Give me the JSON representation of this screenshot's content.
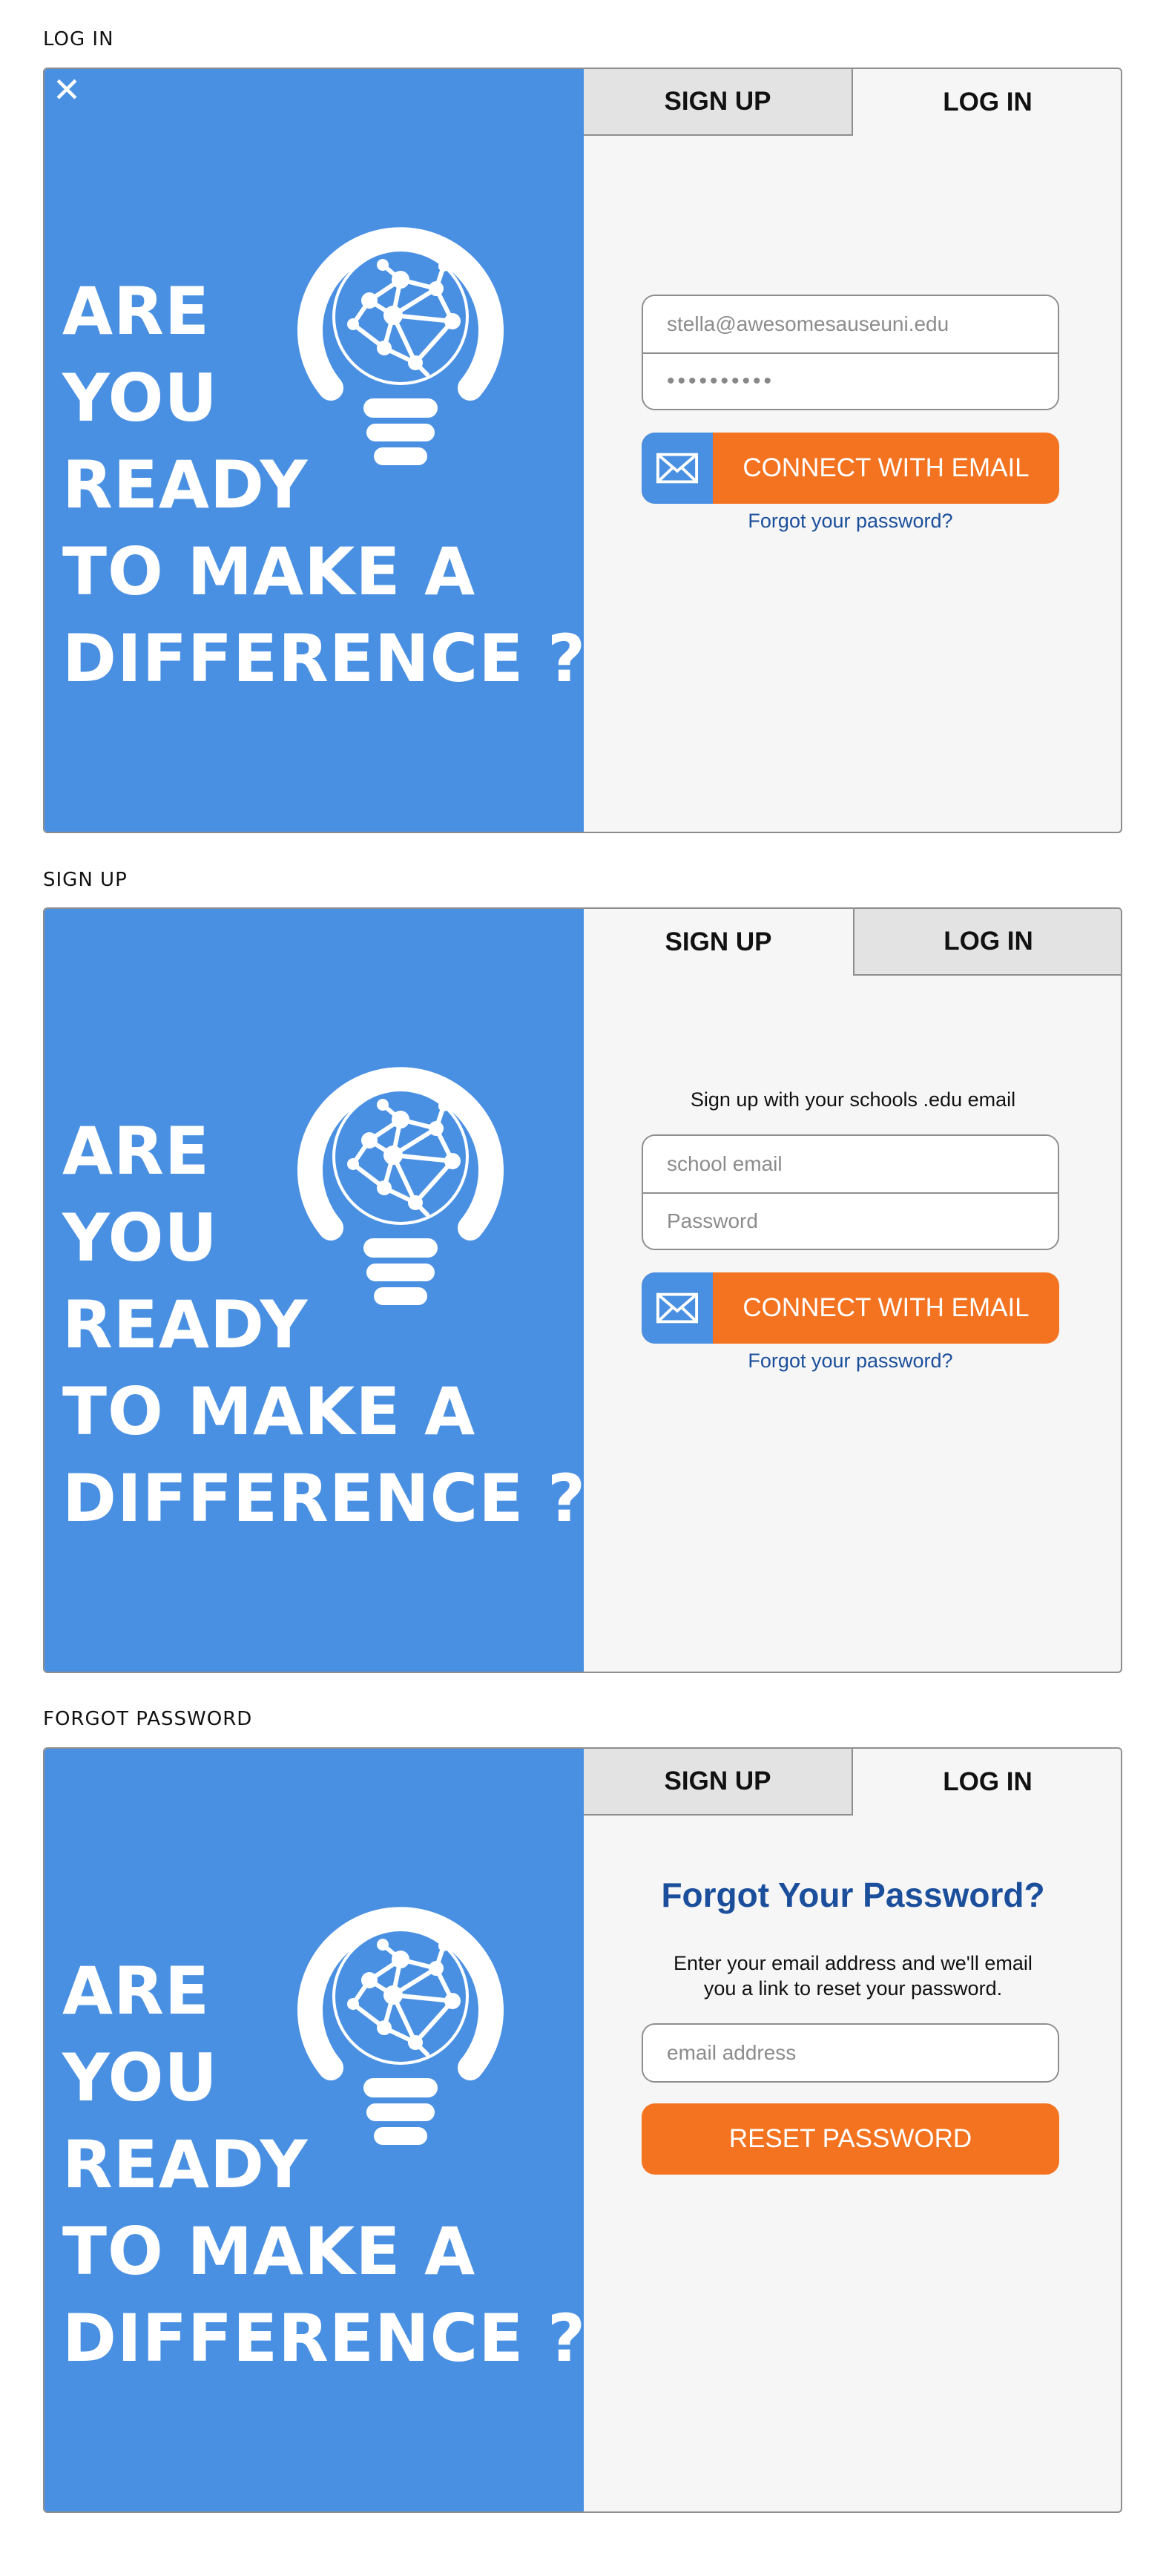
{
  "colors": {
    "brand_blue": "#4a90e2",
    "accent_orange": "#f47321",
    "link_blue": "#1b4f9c",
    "panel_bg": "#f6f6f6",
    "tab_inactive": "#e3e3e3"
  },
  "headline": {
    "line1": "ARE",
    "line2": "YOU",
    "line3": "READY",
    "line4": "TO MAKE A",
    "line5": "DIFFERENCE ?"
  },
  "icons": {
    "logo": "lightbulb-network-icon",
    "close": "close-icon",
    "mail": "mail-icon"
  },
  "login": {
    "section_label": "LOG IN",
    "tab_signup": "SIGN UP",
    "tab_login": "LOG IN",
    "email_value": "stella@awesomesauseuni.edu",
    "password_value": "••••••••••",
    "connect_label": "CONNECT WITH EMAIL",
    "forgot_label": "Forgot your password?"
  },
  "signup": {
    "section_label": "SIGN UP",
    "tab_signup": "SIGN UP",
    "tab_login": "LOG IN",
    "instruction": "Sign up with your schools .edu email",
    "email_placeholder": "school email",
    "password_placeholder": "Password",
    "connect_label": "CONNECT WITH EMAIL",
    "forgot_label": "Forgot your password?"
  },
  "forgot": {
    "section_label": "FORGOT PASSWORD",
    "tab_signup": "SIGN UP",
    "tab_login": "LOG IN",
    "title": "Forgot Your Password?",
    "instruction_line1": "Enter your email address and we'll email",
    "instruction_line2": "you a link to reset your password.",
    "email_placeholder": "email address",
    "reset_label": "RESET PASSWORD"
  }
}
